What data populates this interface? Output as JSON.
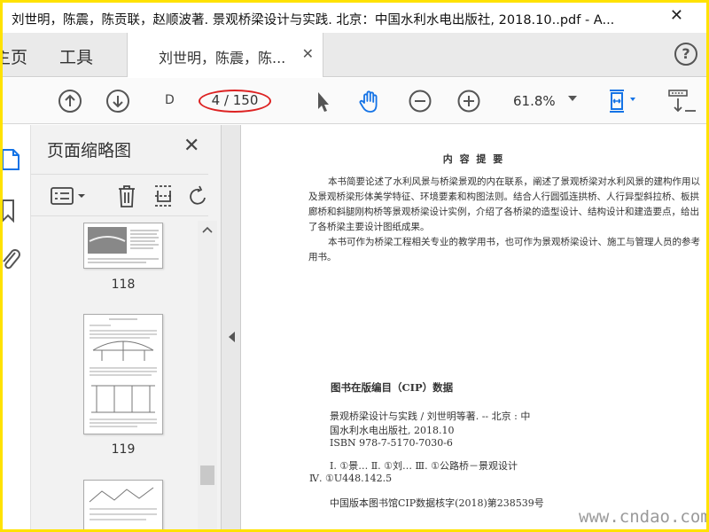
{
  "window": {
    "title": "刘世明，陈震，陈贡联，赵顺波著. 景观桥梁设计与实践. 北京：中国水利水电出版社, 2018.10..pdf - A...",
    "close_glyph": "✕"
  },
  "tabs": {
    "home_label": "主页",
    "tools_label": "工具",
    "document_label": "刘世明，陈震，陈...",
    "close_glyph": "✕",
    "help_glyph": "?"
  },
  "toolbar": {
    "page_input": "D",
    "page_count": "4 / 150",
    "zoom": "61.8%",
    "icons": [
      "arrow-up-circle-icon",
      "arrow-down-circle-icon",
      "cursor-icon",
      "hand-icon",
      "zoom-out-icon",
      "zoom-in-icon",
      "fit-page-icon",
      "scroll-mode-icon"
    ],
    "accent_color": "#1473e6",
    "highlight_color": "#dd2222"
  },
  "panel": {
    "title": "页面缩略图",
    "close_glyph": "✕",
    "thumbnails": [
      {
        "label": "118"
      },
      {
        "label": "119"
      }
    ]
  },
  "document": {
    "heading": "内 容 提 要",
    "para1": "本书简要论述了水利风景与桥梁景观的内在联系，阐述了景观桥梁对水利风景的建构作用以及景观桥梁形体美学特征、环境要素和构图法则。结合人行圆弧连拱桥、人行异型斜拉桥、板拱廊桥和斜腿刚构桥等景观桥梁设计实例，介绍了各桥梁的造型设计、结构设计和建造要点，给出了各桥梁主要设计图纸成果。",
    "para2": "本书可作为桥梁工程相关专业的教学用书，也可作为景观桥梁设计、施工与管理人员的参考用书。",
    "cip_title": "图书在版编目（CIP）数据",
    "cip_line1": "景观桥梁设计与实践 / 刘世明等著. -- 北京 : 中",
    "cip_line2": "国水利水电出版社, 2018.10",
    "cip_line3": "ISBN 978-7-5170-7030-6",
    "cip_line4": "Ⅰ. ①景… Ⅱ. ①刘… Ⅲ. ①公路桥－景观设计",
    "cip_line5": "Ⅳ. ①U448.142.5",
    "cip_line6": "中国版本图书馆CIP数据核字(2018)第238539号"
  },
  "watermark": "www.cndao.com"
}
